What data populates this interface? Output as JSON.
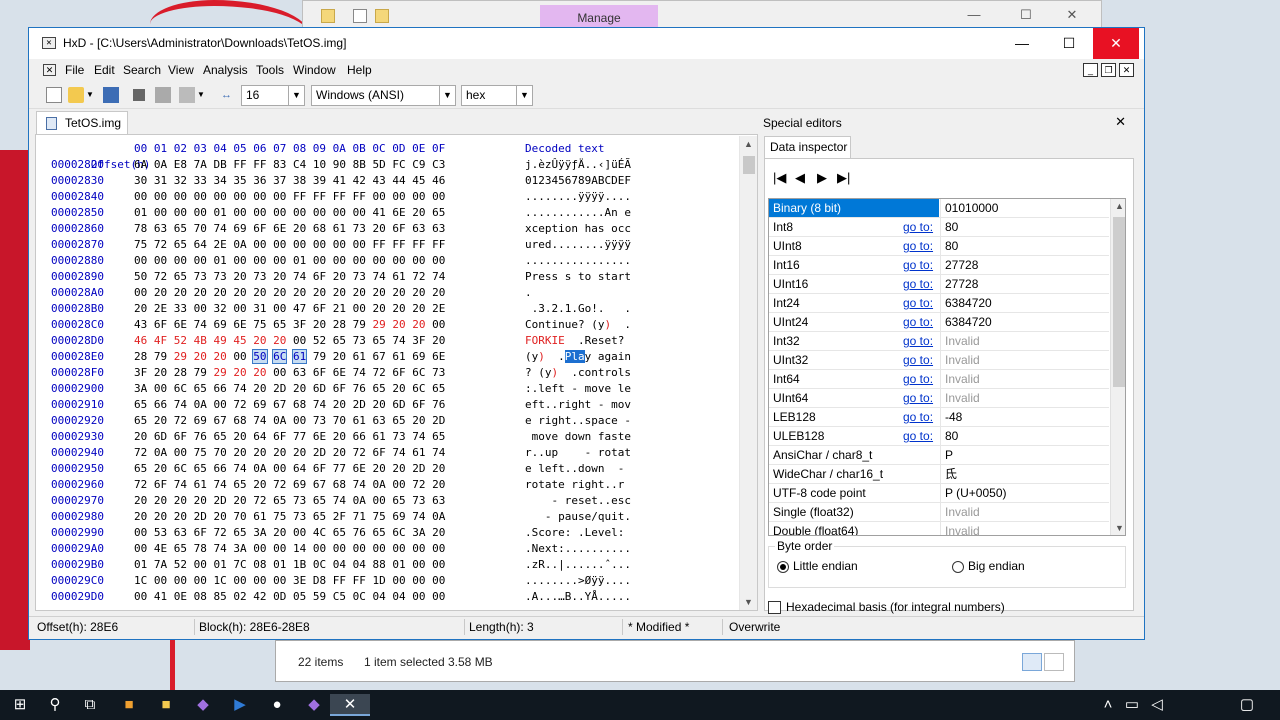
{
  "background": {
    "manage_label": "Manage",
    "explorer_status": {
      "items": "22 items",
      "selected": "1 item selected",
      "size": "3.58 MB"
    }
  },
  "window": {
    "title": "HxD - [C:\\Users\\Administrator\\Downloads\\TetOS.img]",
    "minimize_icon": "minimize-icon",
    "maximize_icon": "maximize-icon",
    "close_icon": "close-icon"
  },
  "menu": [
    "File",
    "Edit",
    "Search",
    "View",
    "Analysis",
    "Tools",
    "Window",
    "Help"
  ],
  "toolbar": {
    "bytes_per_row": "16",
    "charset": "Windows (ANSI)",
    "offset_base": "hex"
  },
  "document_tab": "TetOS.img",
  "hex_view": {
    "header_offset": "Offset(h)",
    "header_bytes": "00 01 02 03 04 05 06 07 08 09 0A 0B 0C 0D 0E 0F",
    "header_decoded": "Decoded text",
    "rows": [
      {
        "offset": "00002820",
        "bytes": "6A 0A E8 7A DB FF FF 83 C4 10 90 8B 5D FC C9 C3",
        "text": "j.èzÛÿÿƒÄ..‹]üÉÃ"
      },
      {
        "offset": "00002830",
        "bytes": "30 31 32 33 34 35 36 37 38 39 41 42 43 44 45 46",
        "text": "0123456789ABCDEF"
      },
      {
        "offset": "00002840",
        "bytes": "00 00 00 00 00 00 00 00 FF FF FF FF 00 00 00 00",
        "text": "........ÿÿÿÿ...."
      },
      {
        "offset": "00002850",
        "bytes": "01 00 00 00 01 00 00 00 00 00 00 00 41 6E 20 65",
        "text": "............An e"
      },
      {
        "offset": "00002860",
        "bytes": "78 63 65 70 74 69 6F 6E 20 68 61 73 20 6F 63 63",
        "text": "xception has occ"
      },
      {
        "offset": "00002870",
        "bytes": "75 72 65 64 2E 0A 00 00 00 00 00 00 FF FF FF FF",
        "text": "ured........ÿÿÿÿ"
      },
      {
        "offset": "00002880",
        "bytes": "00 00 00 00 01 00 00 00 01 00 00 00 00 00 00 00",
        "text": "................"
      },
      {
        "offset": "00002890",
        "bytes": "50 72 65 73 73 20 73 20 74 6F 20 73 74 61 72 74",
        "text": "Press s to start"
      },
      {
        "offset": "000028A0",
        "bytes": "00 20 20 20 20 20 20 20 20 20 20 20 20 20 20 20",
        "text": ".               "
      },
      {
        "offset": "000028B0",
        "bytes": "20 2E 33 00 32 00 31 00 47 6F 21 00 20 20 20 2E",
        "text": " .3.2.1.Go!.   ."
      },
      {
        "offset": "000028C0",
        "bytes": "43 6F 6E 74 69 6E 75 65 3F 20 28 79 29 20 20 00",
        "text": "Continue? (y)  ."
      },
      {
        "offset": "000028D0",
        "bytes": "46 4F 52 4B 49 45 20 20 00 52 65 73 65 74 3F 20",
        "text": "FORKIE  .Reset? "
      },
      {
        "offset": "000028E0",
        "bytes": "28 79 29 20 20 00 50 6C 61 79 20 61 67 61 69 6E",
        "text": "(y)  .Play again"
      },
      {
        "offset": "000028F0",
        "bytes": "3F 20 28 79 29 20 20 00 63 6F 6E 74 72 6F 6C 73",
        "text": "? (y)  .controls"
      },
      {
        "offset": "00002900",
        "bytes": "3A 00 6C 65 66 74 20 2D 20 6D 6F 76 65 20 6C 65",
        "text": ":.left - move le"
      },
      {
        "offset": "00002910",
        "bytes": "65 66 74 0A 00 72 69 67 68 74 20 2D 20 6D 6F 76",
        "text": "eft..right - mov"
      },
      {
        "offset": "00002920",
        "bytes": "65 20 72 69 67 68 74 0A 00 73 70 61 63 65 20 2D",
        "text": "e right..space -"
      },
      {
        "offset": "00002930",
        "bytes": "20 6D 6F 76 65 20 64 6F 77 6E 20 66 61 73 74 65",
        "text": " move down faste"
      },
      {
        "offset": "00002940",
        "bytes": "72 0A 00 75 70 20 20 20 20 2D 20 72 6F 74 61 74",
        "text": "r..up    - rotat"
      },
      {
        "offset": "00002950",
        "bytes": "65 20 6C 65 66 74 0A 00 64 6F 77 6E 20 20 2D 20",
        "text": "e left..down  - "
      },
      {
        "offset": "00002960",
        "bytes": "72 6F 74 61 74 65 20 72 69 67 68 74 0A 00 72 20",
        "text": "rotate right..r "
      },
      {
        "offset": "00002970",
        "bytes": "20 20 20 20 2D 20 72 65 73 65 74 0A 00 65 73 63",
        "text": "    - reset..esc"
      },
      {
        "offset": "00002980",
        "bytes": "20 20 20 2D 20 70 61 75 73 65 2F 71 75 69 74 0A",
        "text": "   - pause/quit."
      },
      {
        "offset": "00002990",
        "bytes": "00 53 63 6F 72 65 3A 20 00 4C 65 76 65 6C 3A 20",
        "text": ".Score: .Level: "
      },
      {
        "offset": "000029A0",
        "bytes": "00 4E 65 78 74 3A 00 00 14 00 00 00 00 00 00 00",
        "text": ".Next:.........."
      },
      {
        "offset": "000029B0",
        "bytes": "01 7A 52 00 01 7C 08 01 1B 0C 04 04 88 01 00 00",
        "text": ".zR..|......ˆ..."
      },
      {
        "offset": "000029C0",
        "bytes": "1C 00 00 00 1C 00 00 00 3E D8 FF FF 1D 00 00 00",
        "text": "........>Øÿÿ...."
      },
      {
        "offset": "000029D0",
        "bytes": "00 41 0E 08 85 02 42 0D 05 59 C5 0C 04 04 00 00",
        "text": ".A...…B..YÅ....."
      }
    ]
  },
  "special_editors": {
    "title": "Special editors",
    "tab": "Data inspector",
    "goto_label": "go to:",
    "rows": [
      {
        "name": "Binary (8 bit)",
        "goto": false,
        "value": "01010000",
        "invalid": false
      },
      {
        "name": "Int8",
        "goto": true,
        "value": "80",
        "invalid": false
      },
      {
        "name": "UInt8",
        "goto": true,
        "value": "80",
        "invalid": false
      },
      {
        "name": "Int16",
        "goto": true,
        "value": "27728",
        "invalid": false
      },
      {
        "name": "UInt16",
        "goto": true,
        "value": "27728",
        "invalid": false
      },
      {
        "name": "Int24",
        "goto": true,
        "value": "6384720",
        "invalid": false
      },
      {
        "name": "UInt24",
        "goto": true,
        "value": "6384720",
        "invalid": false
      },
      {
        "name": "Int32",
        "goto": true,
        "value": "Invalid",
        "invalid": true
      },
      {
        "name": "UInt32",
        "goto": true,
        "value": "Invalid",
        "invalid": true
      },
      {
        "name": "Int64",
        "goto": true,
        "value": "Invalid",
        "invalid": true
      },
      {
        "name": "UInt64",
        "goto": true,
        "value": "Invalid",
        "invalid": true
      },
      {
        "name": "LEB128",
        "goto": true,
        "value": "-48",
        "invalid": false
      },
      {
        "name": "ULEB128",
        "goto": true,
        "value": "80",
        "invalid": false
      },
      {
        "name": "AnsiChar / char8_t",
        "goto": false,
        "value": "P",
        "invalid": false
      },
      {
        "name": "WideChar / char16_t",
        "goto": false,
        "value": "氐",
        "invalid": false
      },
      {
        "name": "UTF-8 code point",
        "goto": false,
        "value": "P (U+0050)",
        "invalid": false
      },
      {
        "name": "Single (float32)",
        "goto": false,
        "value": "Invalid",
        "invalid": true
      },
      {
        "name": "Double (float64)",
        "goto": false,
        "value": "Invalid",
        "invalid": true
      }
    ],
    "byte_order_label": "Byte order",
    "little_endian": "Little endian",
    "big_endian": "Big endian",
    "hex_basis": "Hexadecimal basis (for integral numbers)"
  },
  "status_bar": {
    "offset": "Offset(h): 28E6",
    "block": "Block(h): 28E6-28E8",
    "length": "Length(h): 3",
    "modified": "* Modified *",
    "mode": "Overwrite"
  },
  "colors": {
    "accent": "#0078d7",
    "hex_blue": "#0000c0",
    "highlight_red": "#e02020",
    "close_red": "#e81123"
  }
}
